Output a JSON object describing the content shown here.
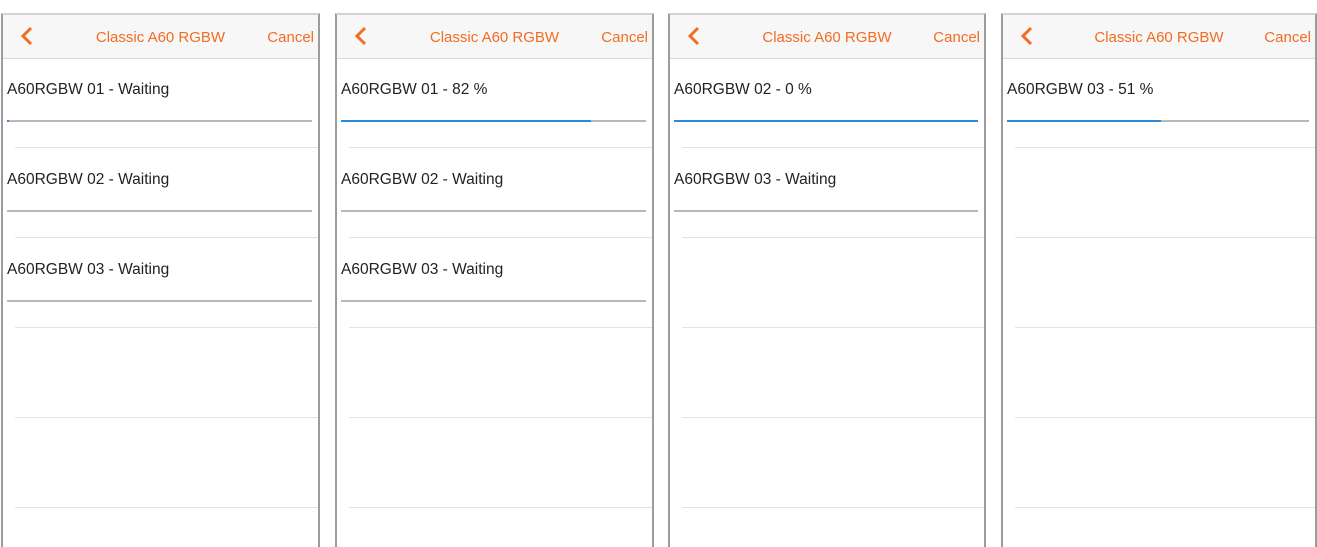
{
  "accent_color": "#f26c22",
  "progress_color": "#2a8bdc",
  "screens": [
    {
      "title": "Classic A60 RGBW",
      "back_icon": "chevron-left-icon",
      "cancel_label": "Cancel",
      "items": [
        {
          "label": "A60RGBW 01 - Waiting",
          "progress": 0.005
        },
        {
          "label": "A60RGBW 02 - Waiting",
          "progress": 0
        },
        {
          "label": "A60RGBW 03 - Waiting",
          "progress": 0
        }
      ]
    },
    {
      "title": "Classic A60 RGBW",
      "back_icon": "chevron-left-icon",
      "cancel_label": "Cancel",
      "items": [
        {
          "label": "A60RGBW 01 - 82 %",
          "progress": 0.82
        },
        {
          "label": "A60RGBW 02 - Waiting",
          "progress": 0
        },
        {
          "label": "A60RGBW 03 - Waiting",
          "progress": 0
        }
      ]
    },
    {
      "title": "Classic A60 RGBW",
      "back_icon": "chevron-left-icon",
      "cancel_label": "Cancel",
      "items": [
        {
          "label": "A60RGBW 02 - 0 %",
          "progress": 1
        },
        {
          "label": "A60RGBW 03 - Waiting",
          "progress": 0
        }
      ]
    },
    {
      "title": "Classic A60 RGBW",
      "back_icon": "chevron-left-icon",
      "cancel_label": "Cancel",
      "items": [
        {
          "label": "A60RGBW 03 - 51 %",
          "progress": 0.51
        }
      ]
    }
  ]
}
